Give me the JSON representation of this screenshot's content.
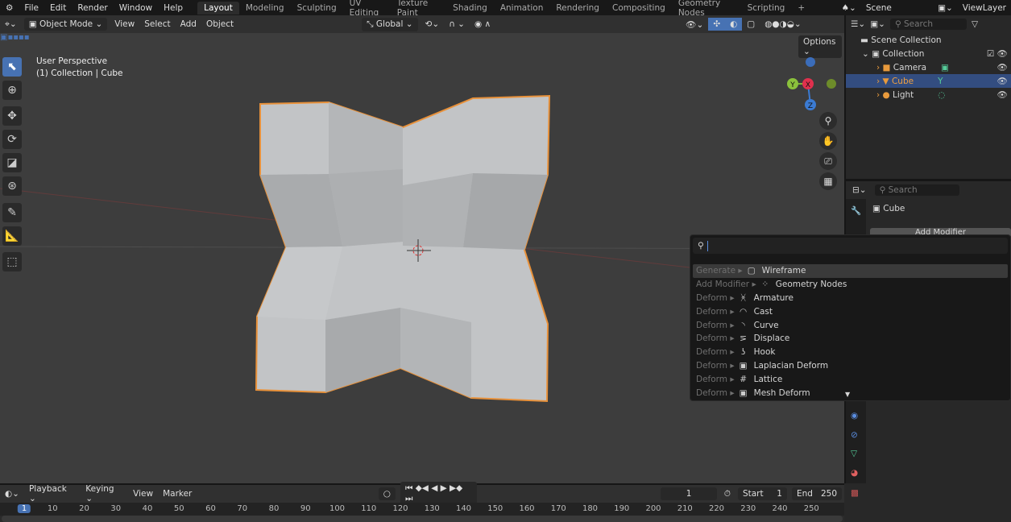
{
  "topbar": {
    "menus": [
      "File",
      "Edit",
      "Render",
      "Window",
      "Help"
    ],
    "workspaces": [
      "Layout",
      "Modeling",
      "Sculpting",
      "UV Editing",
      "Texture Paint",
      "Shading",
      "Animation",
      "Rendering",
      "Compositing",
      "Geometry Nodes",
      "Scripting"
    ],
    "active_workspace": "Layout",
    "add_tab": "+",
    "scene": "Scene",
    "view_layer": "ViewLayer"
  },
  "viewport": {
    "mode": "Object Mode",
    "menus": [
      "View",
      "Select",
      "Add",
      "Object"
    ],
    "orientation": "Global",
    "options": "Options",
    "overlay_text": {
      "perspective": "User Perspective",
      "object": "(1) Collection | Cube"
    },
    "gizmo": {
      "x": "X",
      "y": "Y",
      "z": "Z"
    },
    "colors": {
      "selection_outline": "#e8913a",
      "mesh": "#c0c2c4",
      "background": "#3d3d3d",
      "accent": "#4772b3"
    }
  },
  "outliner": {
    "search_placeholder": "Search",
    "items": [
      {
        "label": "Scene Collection",
        "icon": "scene-collection-icon"
      },
      {
        "label": "Collection",
        "icon": "collection-icon"
      },
      {
        "label": "Camera",
        "icon": "camera-icon"
      },
      {
        "label": "Cube",
        "icon": "mesh-icon",
        "selected": true
      },
      {
        "label": "Light",
        "icon": "light-icon"
      }
    ]
  },
  "properties": {
    "search_placeholder": "Search",
    "object_name": "Cube",
    "add_modifier": "Add Modifier"
  },
  "popup": {
    "search_value": "",
    "items": [
      {
        "category": "Generate",
        "label": "Wireframe",
        "icon": "wireframe-icon",
        "glyph": "▢"
      },
      {
        "category": "Add Modifier",
        "label": "Geometry Nodes",
        "icon": "geometry-nodes-icon",
        "glyph": "⁘"
      },
      {
        "category": "Deform",
        "label": "Armature",
        "icon": "armature-icon",
        "glyph": "ᚸ"
      },
      {
        "category": "Deform",
        "label": "Cast",
        "icon": "cast-icon",
        "glyph": "◠"
      },
      {
        "category": "Deform",
        "label": "Curve",
        "icon": "curve-icon",
        "glyph": "◝"
      },
      {
        "category": "Deform",
        "label": "Displace",
        "icon": "displace-icon",
        "glyph": "⋝"
      },
      {
        "category": "Deform",
        "label": "Hook",
        "icon": "hook-icon",
        "glyph": "ʖ"
      },
      {
        "category": "Deform",
        "label": "Laplacian Deform",
        "icon": "laplacian-deform-icon",
        "glyph": "▣"
      },
      {
        "category": "Deform",
        "label": "Lattice",
        "icon": "lattice-icon",
        "glyph": "#"
      },
      {
        "category": "Deform",
        "label": "Mesh Deform",
        "icon": "mesh-deform-icon",
        "glyph": "▣"
      }
    ],
    "scroll_down": "▼"
  },
  "timeline": {
    "menus": [
      "Playback",
      "Keying",
      "View",
      "Marker"
    ],
    "current_frame": "1",
    "start_label": "Start",
    "start": "1",
    "end_label": "End",
    "end": "250",
    "ticks": [
      "1",
      "10",
      "20",
      "30",
      "40",
      "50",
      "60",
      "70",
      "80",
      "90",
      "100",
      "110",
      "120",
      "130",
      "140",
      "150",
      "160",
      "170",
      "180",
      "190",
      "200",
      "210",
      "220",
      "230",
      "240",
      "250"
    ]
  }
}
